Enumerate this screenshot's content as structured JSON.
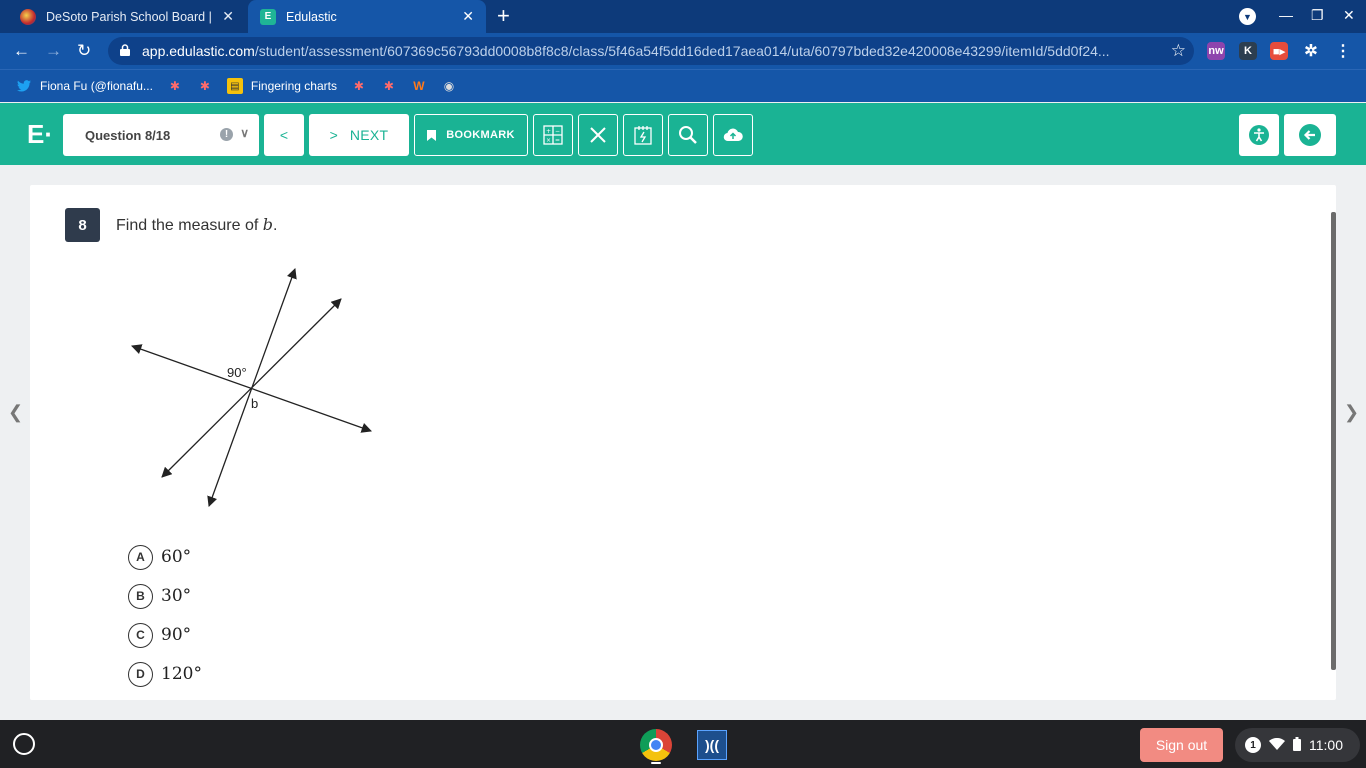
{
  "browser": {
    "tabs": [
      {
        "title": "DeSoto Parish School Board | De",
        "active": false
      },
      {
        "title": "Edulastic",
        "active": true
      }
    ],
    "url_host": "app.edulastic.com",
    "url_path": "/student/assessment/607369c56793dd0008b8f8c8/class/5f46a54f5dd16ded17aea014/uta/60797bded32e420008e43299/itemId/5dd0f24...",
    "bookmarks": [
      {
        "label": "Fiona Fu (@fionafu...",
        "icon": "twitter-icon"
      },
      {
        "label": "",
        "icon": "bookmark-favicon-1"
      },
      {
        "label": "",
        "icon": "bookmark-favicon-2"
      },
      {
        "label": "Fingering charts",
        "icon": "chart-favicon"
      },
      {
        "label": "",
        "icon": "bookmark-favicon-3"
      },
      {
        "label": "",
        "icon": "bookmark-favicon-4"
      },
      {
        "label": "",
        "icon": "w-favicon"
      },
      {
        "label": "",
        "icon": "bookmark-favicon-5"
      }
    ],
    "extensions": [
      {
        "glyph": "nw",
        "color": "#8e44ad"
      },
      {
        "glyph": "K",
        "color": "#2c3e50"
      },
      {
        "glyph": "■▸",
        "color": "#e74c3c"
      }
    ]
  },
  "edulastic": {
    "logo": "E·",
    "question_selector": "Question 8/18",
    "warning_glyph": "!",
    "next_label": "NEXT",
    "bookmark_label": "BOOKMARK",
    "brand_color": "#1ab394"
  },
  "question": {
    "number": "8",
    "stem_prefix": "Find the measure of ",
    "stem_var": "b",
    "stem_suffix": ".",
    "figure": {
      "angle_label": "90°",
      "var_label": "b"
    },
    "choices": [
      {
        "letter": "A",
        "value": "60°"
      },
      {
        "letter": "B",
        "value": "30°"
      },
      {
        "letter": "C",
        "value": "90°"
      },
      {
        "letter": "D",
        "value": "120°"
      }
    ]
  },
  "shelf": {
    "signout_label": "Sign out",
    "notif_count": "1",
    "time": "11:00"
  }
}
